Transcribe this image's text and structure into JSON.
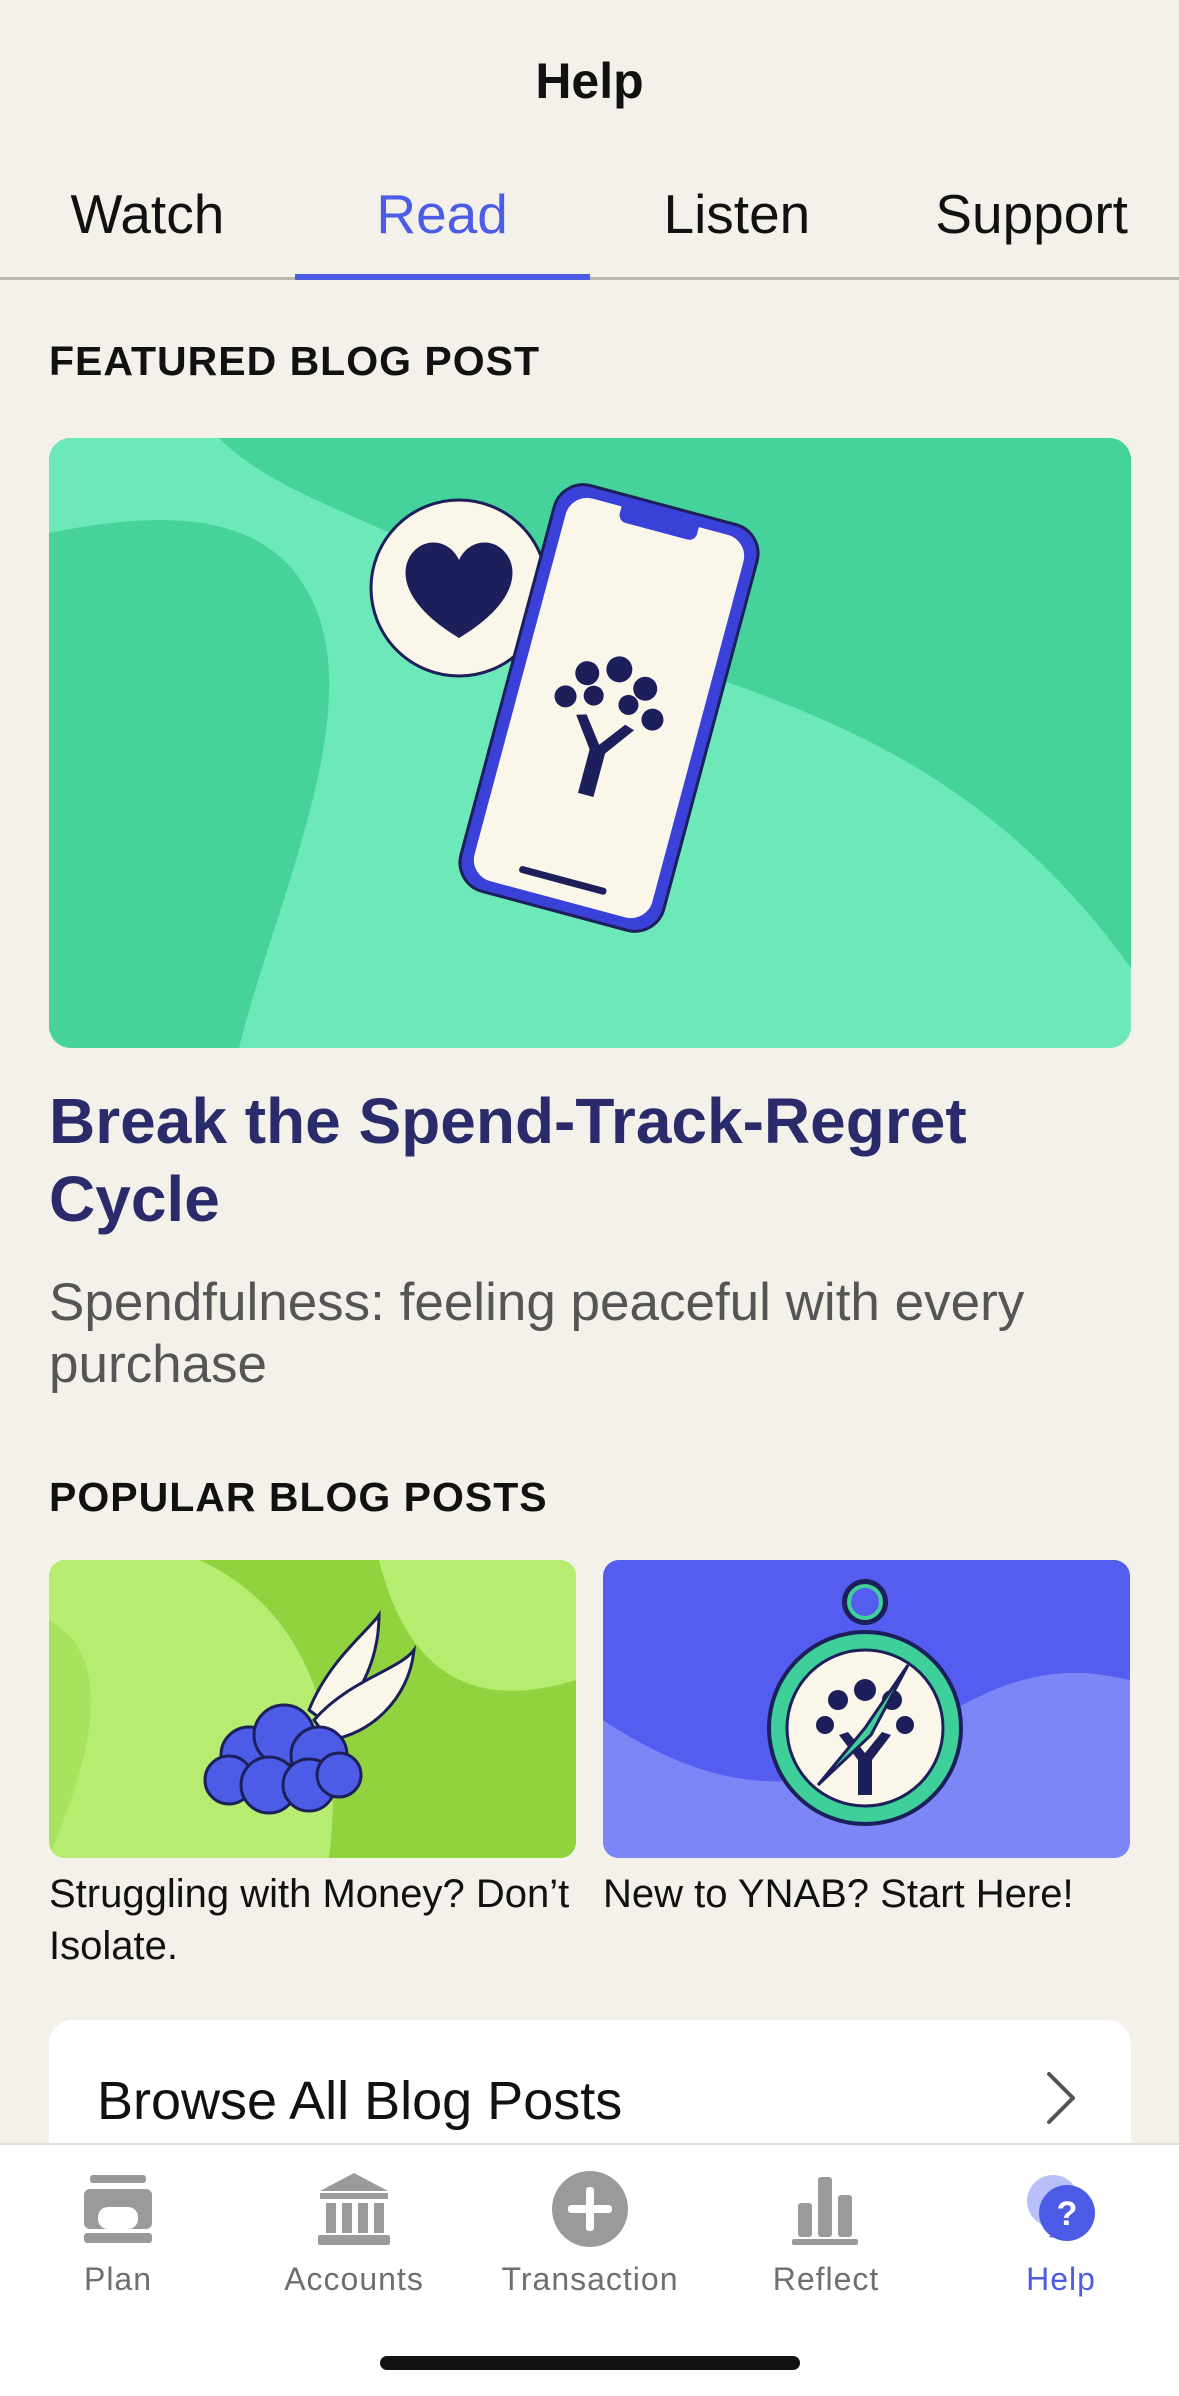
{
  "header": {
    "title": "Help"
  },
  "tabs": [
    {
      "label": "Watch",
      "active": false
    },
    {
      "label": "Read",
      "active": true
    },
    {
      "label": "Listen",
      "active": false
    },
    {
      "label": "Support",
      "active": false
    }
  ],
  "featured": {
    "section_label": "FEATURED BLOG POST",
    "title": "Break the Spend-Track-Regret Cycle",
    "subtitle": "Spendfulness: feeling peaceful with every purchase",
    "image_icon": "phone-heart-illustration"
  },
  "popular": {
    "section_label": "POPULAR BLOG POSTS",
    "posts": [
      {
        "title": "Struggling with Money? Don’t Isolate.",
        "image_icon": "winged-cloud-illustration"
      },
      {
        "title": "New to YNAB? Start Here!",
        "image_icon": "compass-illustration"
      }
    ]
  },
  "browse": {
    "label": "Browse All Blog Posts"
  },
  "bottom_nav": [
    {
      "label": "Plan",
      "icon": "plan-icon",
      "active": false
    },
    {
      "label": "Accounts",
      "icon": "bank-icon",
      "active": false
    },
    {
      "label": "Transaction",
      "icon": "plus-circle-icon",
      "active": false
    },
    {
      "label": "Reflect",
      "icon": "bar-chart-icon",
      "active": false
    },
    {
      "label": "Help",
      "icon": "help-bubble-icon",
      "active": true
    }
  ],
  "colors": {
    "accent": "#4d5ce6",
    "featured_title": "#2a2b6b",
    "background": "#f4f1ea"
  }
}
